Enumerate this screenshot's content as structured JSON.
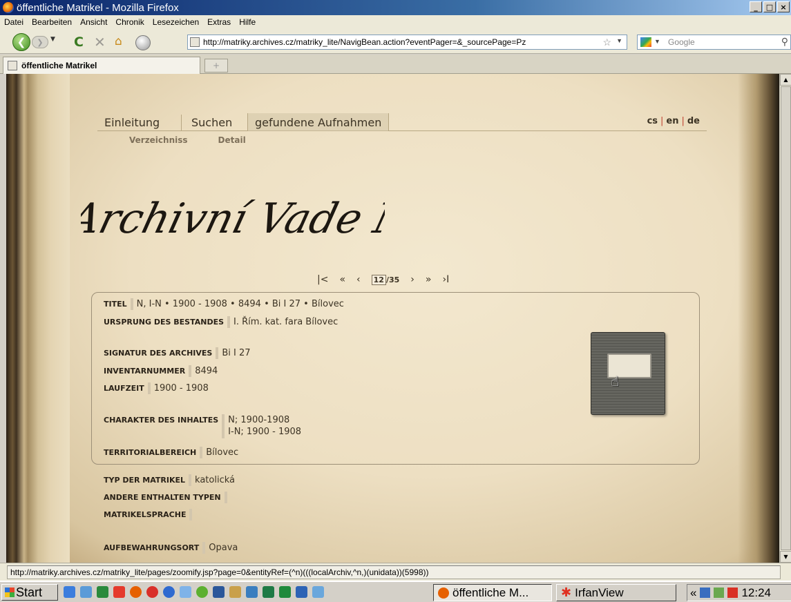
{
  "window": {
    "title": "öffentliche Matrikel - Mozilla Firefox"
  },
  "menu": [
    "Datei",
    "Bearbeiten",
    "Ansicht",
    "Chronik",
    "Lesezeichen",
    "Extras",
    "Hilfe"
  ],
  "nav": {
    "url": "http://matriky.archives.cz/matriky_lite/NavigBean.action?eventPager=&_sourcePage=Pz",
    "search_placeholder": "Google"
  },
  "tab": {
    "title": "öffentliche Matrikel"
  },
  "site": {
    "nav": [
      "Einleitung",
      "Suchen",
      "gefundene Aufnahmen"
    ],
    "langs": [
      "cs",
      "en",
      "de"
    ],
    "subnav": [
      "Verzeichniss",
      "Detail"
    ],
    "logo_text": "Archivní Vade Mecum",
    "pager": {
      "first": "K",
      "prev_fast": "«",
      "prev": "‹",
      "current": "12",
      "total": "/35",
      "next": "›",
      "next_fast": "»",
      "last": "›I"
    }
  },
  "record": {
    "titel": {
      "label": "TITEL",
      "value": "N, I-N • 1900 - 1908 • 8494 • Bi I 27 • Bílovec"
    },
    "ursprung": {
      "label": "URSPRUNG DES BESTANDES",
      "value": "I. Řím. kat. fara Bílovec"
    },
    "signatur": {
      "label": "SIGNATUR DES ARCHIVES",
      "value": "Bi I 27"
    },
    "inventar": {
      "label": "INVENTARNUMMER",
      "value": "8494"
    },
    "laufzeit": {
      "label": "LAUFZEIT",
      "value": "1900 - 1908"
    },
    "charakter": {
      "label": "CHARAKTER DES INHALTES",
      "value1": "N; 1900-1908",
      "value2": "I-N; 1900 - 1908"
    },
    "territorial": {
      "label": "TERRITORIALBEREICH",
      "value": "Bílovec"
    },
    "typ": {
      "label": "TYP DER MATRIKEL",
      "value": "katolická"
    },
    "andere": {
      "label": "ANDERE ENTHALTEN TYPEN",
      "value": ""
    },
    "sprache": {
      "label": "MATRIKELSPRACHE",
      "value": ""
    },
    "ort": {
      "label": "AUFBEWAHRUNGSORT",
      "value": "Opava"
    }
  },
  "status": {
    "text": "http://matriky.archives.cz/matriky_lite/pages/zoomify.jsp?page=0&entityRef=(^n)(((localArchiv,^n,)(unidata))(5998))"
  },
  "taskbar": {
    "start": "Start",
    "tasks": [
      "öffentliche M...",
      "IrfanView"
    ],
    "tray_prefix": "«",
    "clock": "12:24"
  }
}
